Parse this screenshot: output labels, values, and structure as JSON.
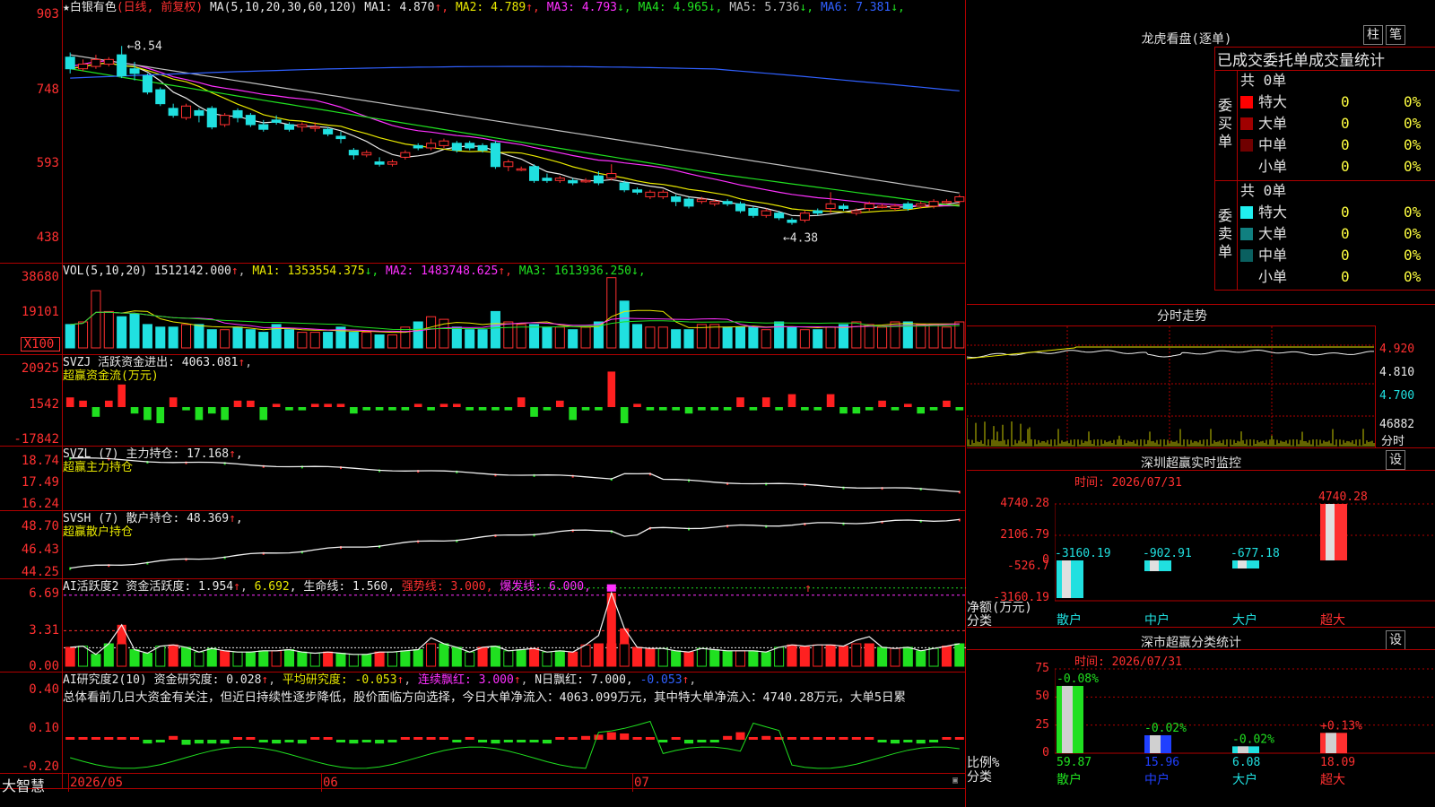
{
  "stock": {
    "name": "白银有色",
    "mode": "(日线, 前复权)"
  },
  "price_panel": {
    "axis": [
      "903",
      "748",
      "593",
      "438"
    ],
    "ma_title": "MA(5,10,20,30,60,120)",
    "ma": [
      {
        "label": "MA1: 4.870",
        "arrow": "↑",
        "color": "#e8e8e8"
      },
      {
        "label": "MA2: 4.789",
        "arrow": "↑",
        "color": "#e8e800"
      },
      {
        "label": "MA3: 4.793",
        "arrow": "↓",
        "color": "#ff30ff"
      },
      {
        "label": "MA4: 4.965",
        "arrow": "↓",
        "color": "#20e020"
      },
      {
        "label": "MA5: 5.736",
        "arrow": "↓",
        "color": "#c0c0c0"
      },
      {
        "label": "MA6: 7.381",
        "arrow": "↓",
        "color": "#3060ff"
      }
    ],
    "high_marker": "8.54",
    "low_marker": "4.38",
    "candles": [
      [
        8.3,
        8.05,
        8.4,
        7.95
      ],
      [
        8.05,
        8.15,
        8.25,
        8.0
      ],
      [
        8.1,
        8.25,
        8.35,
        8.05
      ],
      [
        8.15,
        8.25,
        8.3,
        8.1
      ],
      [
        8.35,
        7.9,
        8.54,
        7.85
      ],
      [
        8.05,
        7.95,
        8.2,
        7.8
      ],
      [
        7.9,
        7.55,
        7.95,
        7.5
      ],
      [
        7.6,
        7.3,
        7.65,
        7.25
      ],
      [
        7.2,
        7.05,
        7.3,
        7.0
      ],
      [
        7.0,
        7.25,
        7.3,
        6.95
      ],
      [
        7.15,
        7.05,
        7.2,
        6.9
      ],
      [
        7.2,
        6.8,
        7.25,
        6.75
      ],
      [
        6.85,
        7.05,
        7.1,
        6.8
      ],
      [
        7.15,
        7.0,
        7.2,
        6.9
      ],
      [
        7.05,
        6.85,
        7.1,
        6.8
      ],
      [
        6.85,
        6.75,
        6.95,
        6.7
      ],
      [
        6.95,
        6.9,
        7.05,
        6.85
      ],
      [
        6.85,
        6.75,
        6.9,
        6.7
      ],
      [
        6.8,
        6.85,
        6.9,
        6.7
      ],
      [
        6.8,
        6.8,
        6.9,
        6.7
      ],
      [
        6.75,
        6.65,
        6.8,
        6.6
      ],
      [
        6.6,
        6.55,
        6.7,
        6.45
      ],
      [
        6.3,
        6.2,
        6.35,
        6.1
      ],
      [
        6.2,
        6.25,
        6.3,
        6.15
      ],
      [
        6.05,
        6.0,
        6.15,
        5.95
      ],
      [
        6.0,
        6.05,
        6.1,
        5.95
      ],
      [
        6.15,
        6.25,
        6.3,
        6.1
      ],
      [
        6.4,
        6.35,
        6.45,
        6.3
      ],
      [
        6.35,
        6.45,
        6.55,
        6.3
      ],
      [
        6.4,
        6.5,
        6.55,
        6.35
      ],
      [
        6.45,
        6.3,
        6.5,
        6.25
      ],
      [
        6.45,
        6.35,
        6.5,
        6.3
      ],
      [
        6.4,
        6.3,
        6.45,
        6.25
      ],
      [
        6.45,
        5.95,
        6.5,
        5.9
      ],
      [
        5.95,
        6.05,
        6.1,
        5.85
      ],
      [
        5.9,
        5.9,
        5.95,
        5.85
      ],
      [
        5.95,
        5.65,
        6.0,
        5.6
      ],
      [
        5.7,
        5.65,
        5.8,
        5.6
      ],
      [
        5.65,
        5.7,
        5.75,
        5.6
      ],
      [
        5.65,
        5.6,
        5.7,
        5.55
      ],
      [
        5.65,
        5.65,
        5.7,
        5.6
      ],
      [
        5.75,
        5.6,
        5.85,
        5.55
      ],
      [
        5.7,
        5.8,
        6.0,
        5.65
      ],
      [
        5.6,
        5.45,
        5.65,
        5.4
      ],
      [
        5.45,
        5.4,
        5.5,
        5.35
      ],
      [
        5.3,
        5.4,
        5.45,
        5.25
      ],
      [
        5.3,
        5.4,
        5.45,
        5.25
      ],
      [
        5.3,
        5.2,
        5.35,
        5.1
      ],
      [
        5.25,
        5.1,
        5.3,
        5.05
      ],
      [
        5.2,
        5.25,
        5.3,
        5.15
      ],
      [
        5.15,
        5.2,
        5.25,
        5.1
      ],
      [
        5.2,
        5.15,
        5.25,
        5.1
      ],
      [
        5.15,
        5.0,
        5.2,
        4.95
      ],
      [
        5.05,
        4.9,
        5.1,
        4.85
      ],
      [
        4.9,
        5.0,
        5.05,
        4.85
      ],
      [
        4.95,
        4.85,
        5.0,
        4.8
      ],
      [
        4.8,
        4.75,
        4.85,
        4.7
      ],
      [
        4.8,
        4.95,
        5.0,
        4.75
      ],
      [
        5.0,
        4.95,
        5.05,
        4.9
      ],
      [
        5.05,
        5.15,
        5.4,
        4.95
      ],
      [
        5.1,
        5.05,
        5.15,
        5.0
      ],
      [
        4.95,
        5.0,
        5.05,
        4.9
      ],
      [
        5.05,
        5.15,
        5.2,
        5.0
      ],
      [
        5.1,
        5.1,
        5.15,
        5.05
      ],
      [
        5.05,
        5.1,
        5.15,
        5.0
      ],
      [
        5.15,
        5.05,
        5.2,
        5.0
      ],
      [
        5.1,
        5.15,
        5.2,
        5.05
      ],
      [
        5.1,
        5.2,
        5.25,
        5.05
      ],
      [
        5.2,
        5.2,
        5.25,
        5.15
      ],
      [
        5.2,
        5.3,
        5.35,
        5.15
      ]
    ]
  },
  "vol_panel": {
    "axis": [
      "38680",
      "19101",
      "X100"
    ],
    "title": "VOL(5,10,20)",
    "val": "1512142.000",
    "ma": [
      {
        "label": "MA1: 1353554.375",
        "arrow": "↓",
        "color": "#e8e800"
      },
      {
        "label": "MA2: 1483748.625",
        "arrow": "↑",
        "color": "#ff30ff"
      },
      {
        "label": "MA3: 1613936.250",
        "arrow": "↓",
        "color": "#20e020"
      }
    ]
  },
  "svzj_panel": {
    "axis": [
      "20925",
      "1542",
      "-17842"
    ],
    "line1_name": "SVZJ",
    "line1_label": "活跃资金进出: 4063.081",
    "line2": "超赢资金流(万元)"
  },
  "svzl_panel": {
    "axis": [
      "18.74",
      "17.49",
      "16.24"
    ],
    "line1": "SVZL (7) 主力持仓: 17.168",
    "line2": "超赢主力持仓"
  },
  "svsh_panel": {
    "axis": [
      "48.70",
      "46.43",
      "44.25"
    ],
    "line1": "SVSH (7) 散户持仓: 48.369",
    "line2": "超赢散户持仓"
  },
  "ai_active_panel": {
    "axis": [
      "6.69",
      "3.31",
      "0.00"
    ],
    "name": "AI活跃度2",
    "label1": "资金活跃度: 1.954",
    "v2": "6.692",
    "label3": "生命线: 1.560",
    "strong": "强势线: 3.000",
    "burst": "爆发线: 6.000"
  },
  "ai_research_panel": {
    "axis": [
      "0.40",
      "0.10",
      "-0.20"
    ],
    "name": "AI研究度2(10)",
    "label1": "资金研究度: 0.028",
    "label2": "平均研究度: -0.053",
    "label3": "连续飘红: 3.000",
    "label4": "N日飘红: 7.000",
    "label5": "-0.053",
    "summary": "总体看前几日大资金有关注，但近日持续性逐步降低，股价面临方向选择，今日大单净流入：4063.099万元，其中特大单净流入：4740.28万元，大单5日累"
  },
  "bottom_bar": {
    "brand": "大智慧",
    "dates": [
      "2026/05",
      "06",
      "07"
    ]
  },
  "right": {
    "dragon": {
      "title": "龙虎看盘(逐单)",
      "btn1": "柱",
      "btn2": "笔",
      "header": "已成交委托单成交量统计",
      "buy": {
        "side": "委买单",
        "total": "共 0单",
        "rows": [
          {
            "name": "特大",
            "n": "0",
            "p": "0%",
            "color": "#ff0000"
          },
          {
            "name": "大单",
            "n": "0",
            "p": "0%",
            "color": "#a00000"
          },
          {
            "name": "中单",
            "n": "0",
            "p": "0%",
            "color": "#700000"
          },
          {
            "name": "小单",
            "n": "0",
            "p": "0%",
            "color": "#000000"
          }
        ]
      },
      "sell": {
        "side": "委卖单",
        "total": "共 0单",
        "rows": [
          {
            "name": "特大",
            "n": "0",
            "p": "0%",
            "color": "#20f0f0"
          },
          {
            "name": "大单",
            "n": "0",
            "p": "0%",
            "color": "#108080"
          },
          {
            "name": "中单",
            "n": "0",
            "p": "0%",
            "color": "#0a6060"
          },
          {
            "name": "小单",
            "n": "0",
            "p": "0%",
            "color": "#000000"
          }
        ]
      }
    },
    "intraday": {
      "title": "分时走势",
      "axis": [
        "4.920",
        "4.810",
        "4.700",
        "46882"
      ],
      "corner": "分时"
    },
    "sz_monitor": {
      "title": "深圳超赢实时监控",
      "btn": "设",
      "time": "时间: 2026/07/31",
      "axis": [
        "4740.28",
        "2106.79",
        "0",
        "-526.7",
        "-3160.19"
      ],
      "ylabel1": "净额(万元)",
      "ylabel2": "分类",
      "bars": [
        {
          "cat": "散户",
          "value": -3160.19,
          "label": "-3160.19"
        },
        {
          "cat": "中户",
          "value": -902.91,
          "label": "-902.91"
        },
        {
          "cat": "大户",
          "value": -677.18,
          "label": "-677.18"
        },
        {
          "cat": "超大",
          "value": 4740.28,
          "label": "4740.28"
        }
      ]
    },
    "sz_class": {
      "title": "深市超赢分类统计",
      "btn": "设",
      "time": "时间: 2026/07/31",
      "axis": [
        "75",
        "50",
        "25",
        "0"
      ],
      "ylabel1": "比例%",
      "ylabel2": "分类",
      "bars": [
        {
          "cat": "散户",
          "value": 59.87,
          "change": "-0.08%",
          "label": "59.87",
          "color": "#20e020"
        },
        {
          "cat": "中户",
          "value": 15.96,
          "change": "-0.02%",
          "label": "15.96",
          "color": "#2040ff"
        },
        {
          "cat": "大户",
          "value": 6.08,
          "change": "-0.02%",
          "label": "6.08",
          "color": "#20e0e0"
        },
        {
          "cat": "超大",
          "value": 18.09,
          "change": "+0.13%",
          "label": "18.09",
          "color": "#ff3030"
        }
      ]
    }
  }
}
